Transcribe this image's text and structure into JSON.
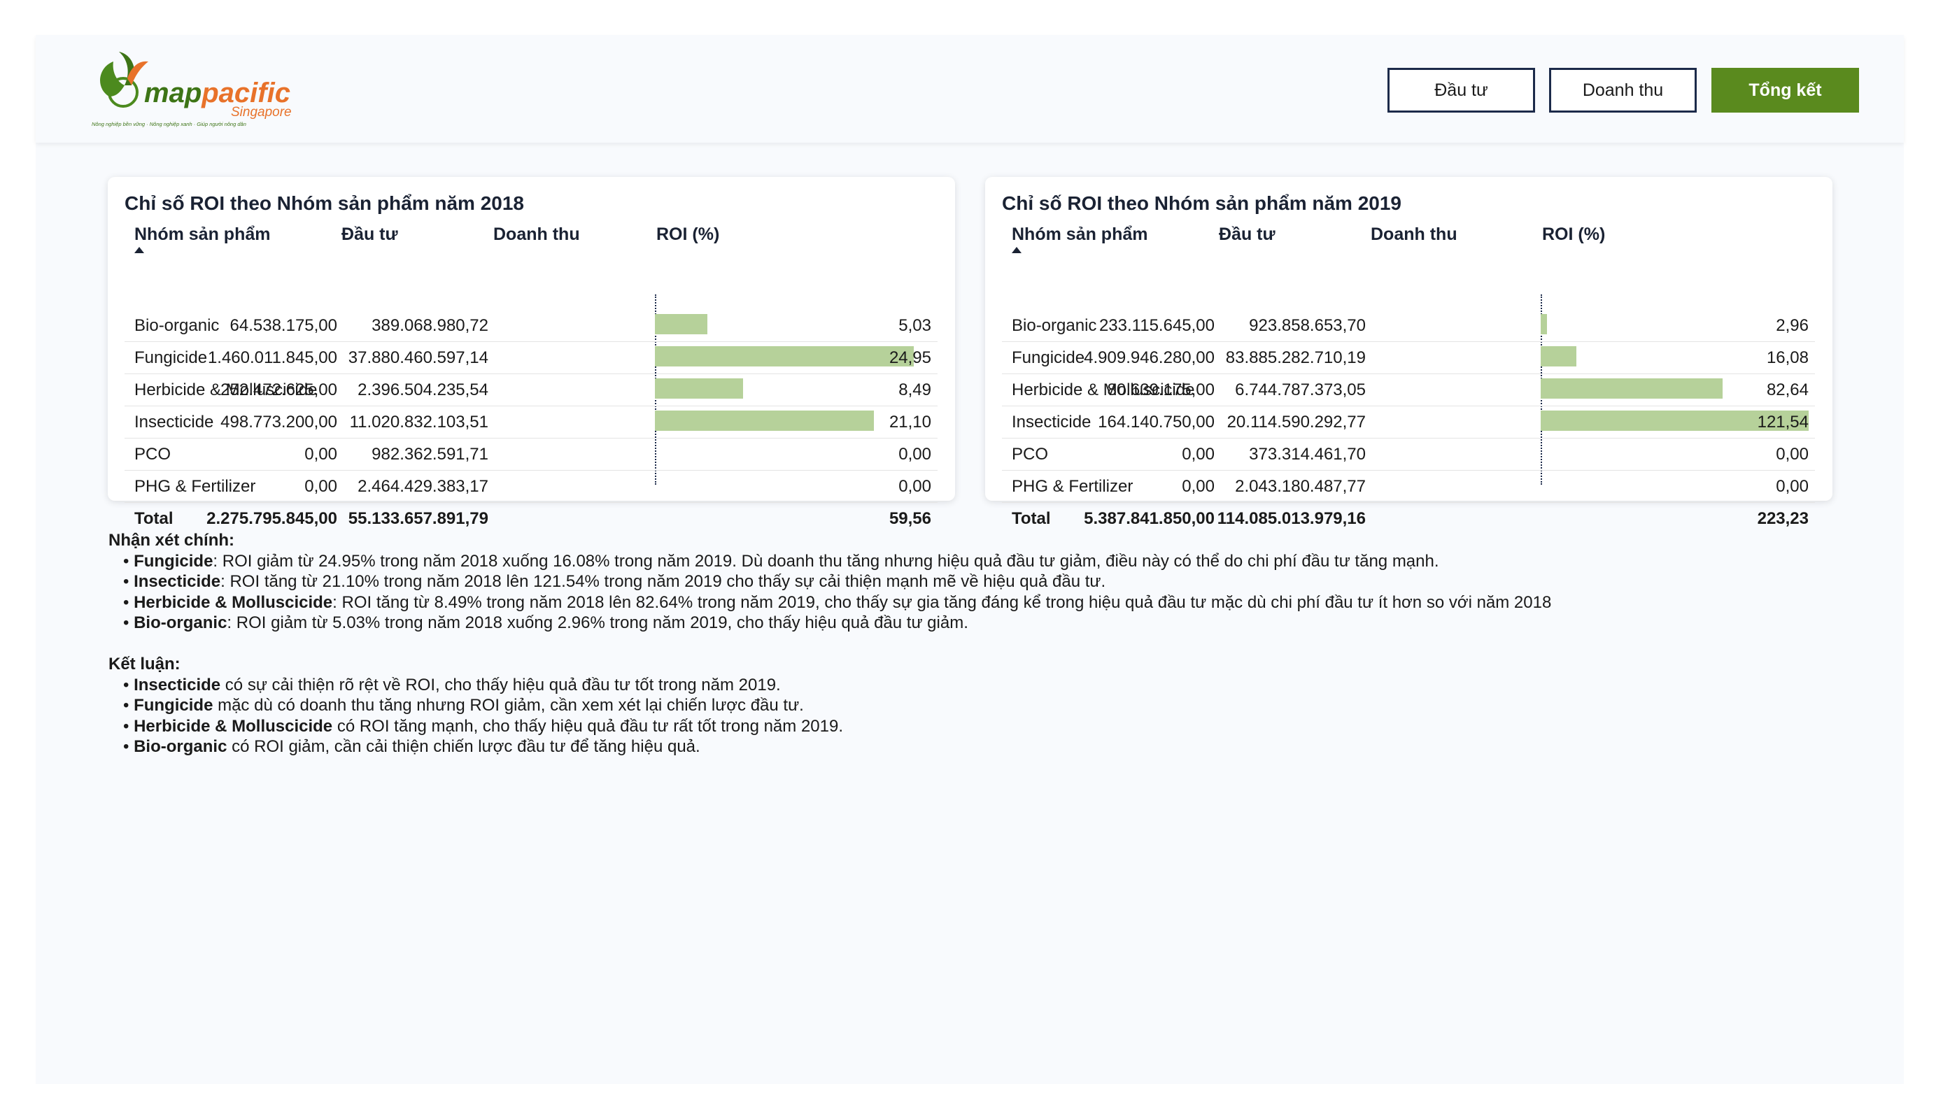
{
  "brand": {
    "name_part1": "map",
    "name_part2": "pacific",
    "subname": "Singapore",
    "tagline": "Nông nghiệp bền vững · Nông nghiệp xanh · Giúp người nông dân"
  },
  "nav": {
    "invest": "Đầu tư",
    "revenue": "Doanh thu",
    "summary": "Tổng kết",
    "active": "summary"
  },
  "colors": {
    "accent": "#5a8a1e",
    "bar": "#b6d19a",
    "navy": "#1c2a4a"
  },
  "tables": [
    {
      "title": "Chỉ số ROI theo Nhóm sản phẩm năm 2018",
      "headers": {
        "group": "Nhóm sản phẩm",
        "invest": "Đầu tư",
        "revenue": "Doanh thu",
        "roi": "ROI (%)"
      },
      "rows": [
        {
          "group": "Bio-organic",
          "invest": "64.538.175,00",
          "revenue": "389.068.980,72",
          "roi": "5,03",
          "roi_value": 5.03
        },
        {
          "group": "Fungicide",
          "invest": "1.460.011.845,00",
          "revenue": "37.880.460.597,14",
          "roi": "24,95",
          "roi_value": 24.95
        },
        {
          "group": "Herbicide & Molluscicide",
          "invest": "252.472.625,00",
          "revenue": "2.396.504.235,54",
          "roi": "8,49",
          "roi_value": 8.49
        },
        {
          "group": "Insecticide",
          "invest": "498.773.200,00",
          "revenue": "11.020.832.103,51",
          "roi": "21,10",
          "roi_value": 21.1
        },
        {
          "group": "PCO",
          "invest": "0,00",
          "revenue": "982.362.591,71",
          "roi": "0,00",
          "roi_value": 0
        },
        {
          "group": "PHG & Fertilizer",
          "invest": "0,00",
          "revenue": "2.464.429.383,17",
          "roi": "0,00",
          "roi_value": 0
        }
      ],
      "total": {
        "group": "Total",
        "invest": "2.275.795.845,00",
        "revenue": "55.133.657.891,79",
        "roi": "59,56"
      }
    },
    {
      "title": "Chỉ số ROI theo Nhóm sản phẩm năm 2019",
      "headers": {
        "group": "Nhóm sản phẩm",
        "invest": "Đầu tư",
        "revenue": "Doanh thu",
        "roi": "ROI (%)"
      },
      "rows": [
        {
          "group": "Bio-organic",
          "invest": "233.115.645,00",
          "revenue": "923.858.653,70",
          "roi": "2,96",
          "roi_value": 2.96
        },
        {
          "group": "Fungicide",
          "invest": "4.909.946.280,00",
          "revenue": "83.885.282.710,19",
          "roi": "16,08",
          "roi_value": 16.08
        },
        {
          "group": "Herbicide & Molluscicide",
          "invest": "80.639.175,00",
          "revenue": "6.744.787.373,05",
          "roi": "82,64",
          "roi_value": 82.64
        },
        {
          "group": "Insecticide",
          "invest": "164.140.750,00",
          "revenue": "20.114.590.292,77",
          "roi": "121,54",
          "roi_value": 121.54
        },
        {
          "group": "PCO",
          "invest": "0,00",
          "revenue": "373.314.461,70",
          "roi": "0,00",
          "roi_value": 0
        },
        {
          "group": "PHG & Fertilizer",
          "invest": "0,00",
          "revenue": "2.043.180.487,77",
          "roi": "0,00",
          "roi_value": 0
        }
      ],
      "total": {
        "group": "Total",
        "invest": "5.387.841.850,00",
        "revenue": "114.085.013.979,16",
        "roi": "223,23"
      }
    }
  ],
  "notes": {
    "observations_title": "Nhận xét chính:",
    "observations": [
      {
        "term": "Fungicide",
        "text": ": ROI giảm từ 24.95% trong năm 2018 xuống 16.08% trong năm 2019. Dù doanh thu tăng nhưng hiệu quả đầu tư giảm, điều này có thể do chi phí đầu tư tăng mạnh."
      },
      {
        "term": "Insecticide",
        "text": ": ROI tăng từ 21.10% trong năm 2018 lên 121.54% trong năm 2019 cho thấy sự cải thiện mạnh mẽ về hiệu quả đầu tư."
      },
      {
        "term": "Herbicide & Molluscicide",
        "text": ": ROI tăng từ 8.49% trong năm 2018 lên 82.64% trong năm 2019, cho thấy sự gia tăng đáng kể trong hiệu quả đầu tư mặc dù chi phí đầu tư ít hơn so với năm 2018"
      },
      {
        "term": "Bio-organic",
        "text": ": ROI giảm từ 5.03% trong năm 2018 xuống 2.96% trong năm 2019, cho thấy hiệu quả đầu tư giảm."
      }
    ],
    "conclusion_title": "Kết luận:",
    "conclusions": [
      {
        "term": "Insecticide",
        "text": " có sự cải thiện rõ rệt về ROI, cho thấy hiệu quả đầu tư tốt trong năm 2019."
      },
      {
        "term": "Fungicide",
        "text": " mặc dù có doanh thu tăng nhưng ROI giảm, cần xem xét lại chiến lược đầu tư."
      },
      {
        "term": "Herbicide & Molluscicide",
        "text": " có ROI tăng mạnh, cho thấy hiệu quả đầu tư rất tốt trong năm 2019."
      },
      {
        "term": "Bio-organic",
        "text": " có ROI giảm, cần cải thiện chiến lược đầu tư để tăng hiệu quả."
      }
    ]
  }
}
